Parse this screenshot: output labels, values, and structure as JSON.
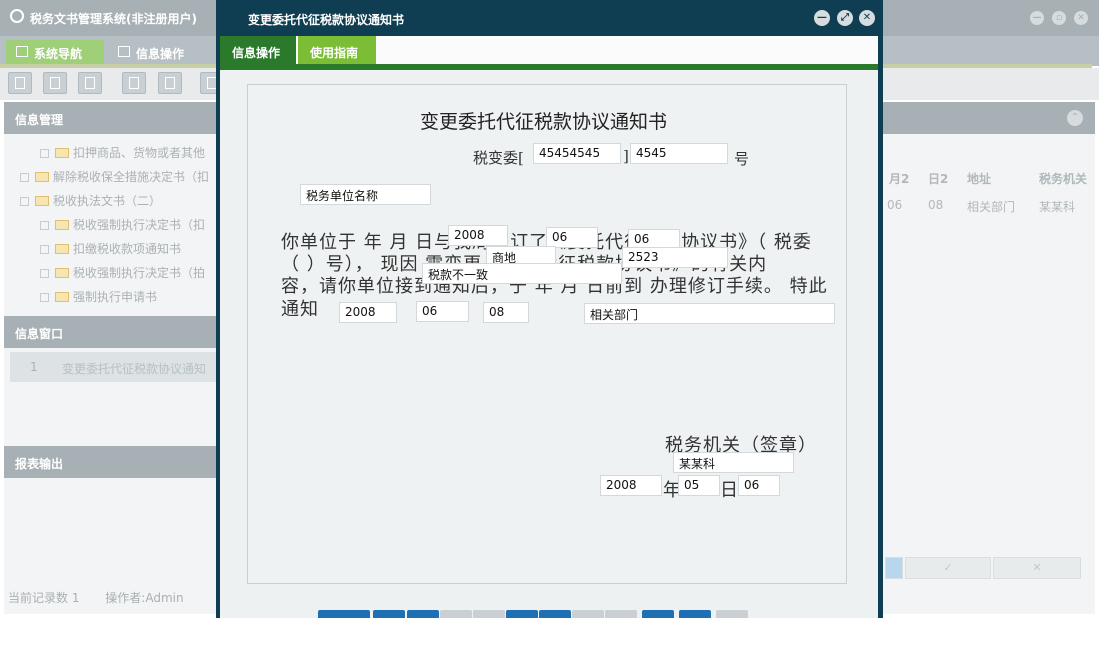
{
  "app": {
    "title": "税务文书管理系统(非注册用户)",
    "tabs": [
      {
        "label": "系统导航",
        "color": "#9fcf78"
      },
      {
        "label": "信息操作",
        "color": "#b6c0c4"
      }
    ],
    "left_panel": {
      "info_manage_title": "信息管理",
      "tree": [
        "扣押商品、货物或者其他",
        "解除税收保全措施决定书（扣",
        "税收执法文书（二）",
        "税收强制执行决定书（扣",
        "扣缴税收款项通知书",
        "税收强制执行决定书（拍",
        "强制执行申请书"
      ],
      "info_window_title": "信息窗口",
      "window_row": {
        "num": "1",
        "label": "变更委托代征税款协议通知"
      },
      "report_title": "报表输出",
      "status_count": "当前记录数 1",
      "status_operator": "操作者:Admin"
    },
    "right_panel": {
      "columns": [
        "月2",
        "日2",
        "地址",
        "税务机关"
      ],
      "row": [
        "06",
        "08",
        "相关部门",
        "某某科"
      ],
      "buttons": [
        "✓",
        "✕"
      ]
    }
  },
  "modal": {
    "title": "变更委托代征税款协议通知书",
    "tabs": [
      {
        "label": "信息操作",
        "active": true
      },
      {
        "label": "使用指南",
        "active": false
      }
    ],
    "doc": {
      "title": "变更委托代征税款协议通知书",
      "ref_prefix": "税变委[",
      "ref_year": "45454545",
      "ref_mid": "]",
      "ref_num": "4545",
      "ref_suffix": "号",
      "unit_name": "税务单位名称",
      "line1": "你单位于 年 月 日与我局签订了《委托代征税款协议书》（ 税委",
      "line2": "（ ）号）， 现因      需变更《委托代征税款协议书》的有关内",
      "line3": "容，请你单位接到通知后，于 年 月 日前到 办理修订手续。 特此",
      "line4": "通知",
      "sign_year": "2008",
      "sign_month": "06",
      "sign_day": "06",
      "agreement_no": "商地",
      "agreement_no2": "2523",
      "reason": "税款不一致",
      "deadline_year": "2008",
      "deadline_month": "06",
      "deadline_day": "08",
      "place": "相关部门",
      "seal_label": "税务机关（签章）",
      "seal_office": "某某科",
      "date_year": "2008",
      "date_year_label": "年",
      "date_month": "05",
      "date_day_label": "日",
      "date_day": "06"
    }
  },
  "colors": {
    "modal_frame": "#0f3d52",
    "tab_active": "#2b7a2b",
    "tab_secondary": "#7cbd36",
    "button_blue": "#1f6fb5",
    "button_gray": "#c9cfd2"
  }
}
